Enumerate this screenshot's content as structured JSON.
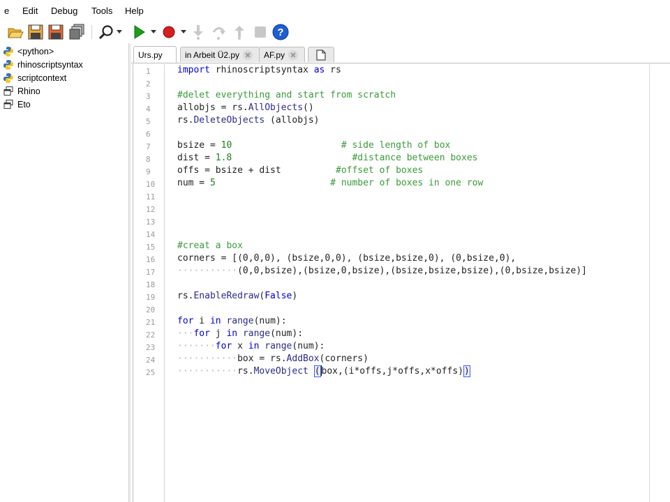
{
  "menu": [
    "e",
    "Edit",
    "Debug",
    "Tools",
    "Help"
  ],
  "toolbar": {
    "buttons": [
      "open-icon",
      "save-icon",
      "save-as-icon",
      "save-all-icon",
      "find-icon",
      "run-icon",
      "breakpoint-icon",
      "step-into-icon",
      "step-over-icon",
      "step-out-icon",
      "stop-icon",
      "help-icon"
    ]
  },
  "tree": {
    "items": [
      {
        "label": "<python>",
        "icon": "python-icon"
      },
      {
        "label": "rhinoscriptsyntax",
        "icon": "python-icon"
      },
      {
        "label": "scriptcontext",
        "icon": "python-icon"
      },
      {
        "label": "Rhino",
        "icon": "namespace-icon"
      },
      {
        "label": "Eto",
        "icon": "namespace-icon"
      }
    ]
  },
  "tabs": [
    {
      "label": "Urs.py",
      "active": true
    },
    {
      "label": "in Arbeit Ü2.py",
      "active": false
    },
    {
      "label": "AF.py",
      "active": false
    }
  ],
  "editor": {
    "line_numbers": [
      "1",
      "2",
      "3",
      "4",
      "5",
      "6",
      "7",
      "8",
      "9",
      "10",
      "11",
      "12",
      "13",
      "14",
      "15",
      "16",
      "17",
      "18",
      "19",
      "20",
      "21",
      "22",
      "23",
      "24",
      "25"
    ],
    "lines": {
      "l1_kw1": "import",
      "l1_mod": " rhinoscriptsyntax ",
      "l1_kw2": "as",
      "l1_alias": " rs",
      "l3_comment": "#delet everything and start from scratch",
      "l4_a": "allobjs = rs.",
      "l4_fn": "AllObjects",
      "l4_b": "()",
      "l5_a": "rs.",
      "l5_fn": "DeleteObjects",
      "l5_b": " (allobjs)",
      "l7_a": "bsize = ",
      "l7_num": "10",
      "l7_pad": "                    ",
      "l7_cm": "# side length of box",
      "l8_a": "dist = ",
      "l8_num": "1.8",
      "l8_pad": "                      ",
      "l8_cm": "#distance between boxes",
      "l9_a": "offs = bsize + dist",
      "l9_pad": "          ",
      "l9_cm": "#offset of boxes",
      "l10_a": "num = ",
      "l10_num": "5",
      "l10_pad": "                     ",
      "l10_cm": "# number of boxes in one row",
      "l15_comment": "#creat a box",
      "l16_text": "corners = [(0,0,0), (bsize,0,0), (bsize,bsize,0), (0,bsize,0),",
      "l17_dots": "···········",
      "l17_text": "(0,0,bsize),(bsize,0,bsize),(bsize,bsize,bsize),(0,bsize,bsize)]",
      "l19_a": "rs.",
      "l19_fn": "EnableRedraw",
      "l19_b": "(",
      "l19_kw": "False",
      "l19_c": ")",
      "l21_kw1": "for",
      "l21_a": " i ",
      "l21_kw2": "in",
      "l21_a2": " ",
      "l21_fn": "range",
      "l21_b": "(num):",
      "l22_dots": "···",
      "l22_kw1": "for",
      "l22_a": " j ",
      "l22_kw2": "in",
      "l22_a2": " ",
      "l22_fn": "range",
      "l22_b": "(num):",
      "l23_dots": "·······",
      "l23_kw1": "for",
      "l23_a": " x ",
      "l23_kw2": "in",
      "l23_a2": " ",
      "l23_fn": "range",
      "l23_b": "(num):",
      "l24_dots": "···········",
      "l24_a": "box = rs.",
      "l24_fn": "AddBox",
      "l24_b": "(corners)",
      "l25_dots": "···········",
      "l25_a": "rs.",
      "l25_fn": "MoveObject",
      "l25_sp": " ",
      "l25_br1": "(",
      "l25_b": "box,(i*offs,j*offs,x*offs)",
      "l25_br2": ")"
    }
  },
  "colors": {
    "keyword": "#0000d8",
    "comment": "#3a9a3a",
    "run_green": "#1aa01a",
    "breakpoint_red": "#d42020",
    "help_blue": "#1f5fd0"
  }
}
